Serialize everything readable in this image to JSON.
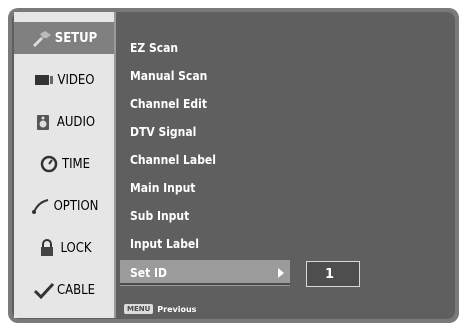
{
  "tabs": [
    {
      "label": "SETUP",
      "icon": "setup-icon",
      "active": true
    },
    {
      "label": "VIDEO",
      "icon": "video-icon",
      "active": false
    },
    {
      "label": "AUDIO",
      "icon": "audio-icon",
      "active": false
    },
    {
      "label": "TIME",
      "icon": "time-icon",
      "active": false
    },
    {
      "label": "OPTION",
      "icon": "option-icon",
      "active": false
    },
    {
      "label": "LOCK",
      "icon": "lock-icon",
      "active": false
    },
    {
      "label": "CABLE",
      "icon": "cable-icon",
      "active": false
    }
  ],
  "menu": {
    "items": [
      "EZ Scan",
      "Manual Scan",
      "Channel Edit",
      "DTV Signal",
      "Channel Label",
      "Main Input",
      "Sub Input",
      "Input Label",
      "Set ID"
    ],
    "selected_index": 8
  },
  "set_id": {
    "value": "1"
  },
  "footer": {
    "key_label": "MENU",
    "text": "Previous"
  },
  "colors": {
    "background": "#5f5f5f",
    "tab_active": "#808080",
    "selected_row": "#9b9b9b"
  }
}
